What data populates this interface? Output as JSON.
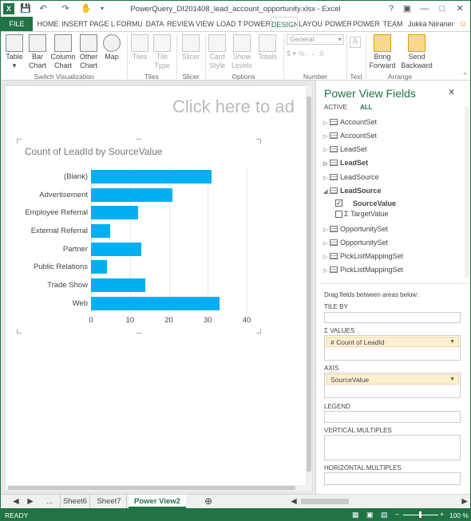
{
  "window": {
    "title": "PowerQuery_DI201408_lead_account_opportunity.xlsx - Excel",
    "user": "Jukka Niiranen"
  },
  "quick_access": [
    "save-icon",
    "undo-icon",
    "redo-icon",
    "touch-mode-icon"
  ],
  "tabs": [
    "FILE",
    "HOME",
    "INSERT",
    "PAGE L",
    "FORMU",
    "DATA",
    "REVIEW",
    "VIEW",
    "LOAD T",
    "POWER",
    "DESIGN",
    "LAYOU",
    "POWER",
    "POWER",
    "TEAM"
  ],
  "active_tab": "DESIGN",
  "ribbon": {
    "switch_visualization": {
      "label": "Switch Visualization",
      "buttons": [
        "Table",
        "Bar Chart",
        "Column Chart",
        "Other Chart",
        "Map"
      ]
    },
    "tiles": {
      "label": "Tiles",
      "buttons": [
        "Tiles",
        "Tile Type"
      ]
    },
    "slicer": {
      "label": "Slicer",
      "buttons": [
        "Slicer"
      ]
    },
    "options": {
      "label": "Options",
      "buttons": [
        "Card Style",
        "Show Levels",
        "Totals"
      ]
    },
    "number": {
      "label": "Number",
      "format": "General"
    },
    "text": {
      "label": "Text"
    },
    "arrange": {
      "label": "Arrange",
      "buttons": [
        "Bring Forward",
        "Send Backward"
      ]
    }
  },
  "canvas": {
    "title_placeholder": "Click here to ad"
  },
  "chart_data": {
    "type": "bar",
    "title": "Count of LeadId by SourceValue",
    "categories": [
      "(Blank)",
      "Advertisement",
      "Employee Referral",
      "External Referral",
      "Partner",
      "Public Relations",
      "Trade Show",
      "Web"
    ],
    "values": [
      31,
      21,
      12,
      5,
      13,
      4,
      14,
      33
    ],
    "xlim": [
      0,
      40
    ],
    "ticks": [
      0,
      10,
      20,
      30,
      40
    ],
    "color": "#00b0f0",
    "grid": true
  },
  "field_pane": {
    "title": "Power View Fields",
    "tabs": [
      "ACTIVE",
      "ALL"
    ],
    "active_tab": "ALL",
    "fields": [
      {
        "name": "AccountSet",
        "bold": false
      },
      {
        "name": "AccountSet",
        "bold": false
      },
      {
        "name": "LeadSet",
        "bold": false
      },
      {
        "name": "LeadSet",
        "bold": true
      },
      {
        "name": "LeadSource",
        "bold": false
      },
      {
        "name": "LeadSource",
        "bold": true,
        "expanded": true
      }
    ],
    "subfields": [
      {
        "name": "SourceValue",
        "checked": true,
        "bold": true
      },
      {
        "name": "TargetValue",
        "checked": false,
        "bold": false,
        "sigma": true
      }
    ],
    "fields_after": [
      "OpportunitySet",
      "OpportunitySet",
      "PickListMappingSet",
      "PickListMappingSet"
    ],
    "drag_hint": "Drag fields between areas below:",
    "areas": {
      "tile_by": "TILE BY",
      "values": "VALUES",
      "values_item": "Count of LeadId",
      "axis": "AXIS",
      "axis_item": "SourceValue",
      "legend": "LEGEND",
      "vertical_multiples": "VERTICAL MULTIPLES",
      "horizontal_multiples": "HORIZONTAL MULTIPLES"
    }
  },
  "sheet_tabs": [
    "...",
    "Sheet6",
    "Sheet7",
    "Power View2"
  ],
  "active_sheet": "Power View2",
  "status": {
    "ready": "READY",
    "zoom": "100 %"
  },
  "colors": {
    "excel_green": "#217346",
    "bar": "#00b0f0"
  }
}
